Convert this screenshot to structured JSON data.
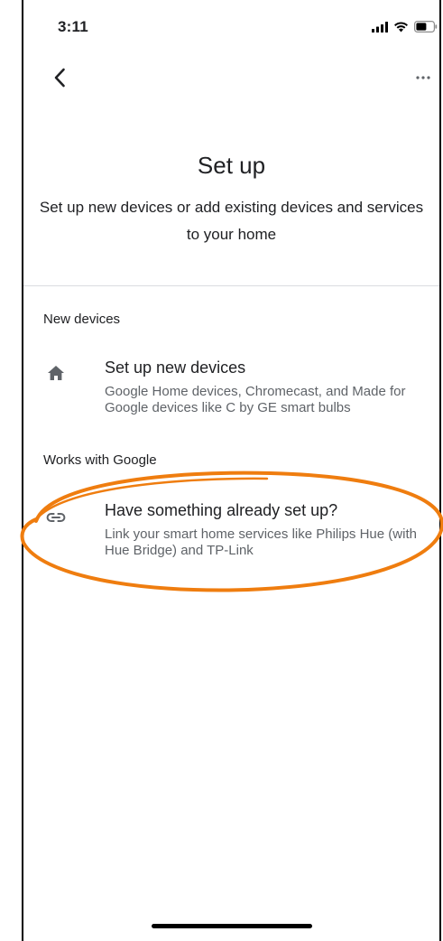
{
  "status_bar": {
    "time": "3:11",
    "icons": [
      "cellular-signal-icon",
      "wifi-icon",
      "battery-icon"
    ]
  },
  "nav": {
    "back_icon": "chevron-left-icon",
    "more_icon": "more-horizontal-icon"
  },
  "header": {
    "title": "Set up",
    "subtitle": "Set up new devices or add existing devices and services to your home"
  },
  "sections": [
    {
      "label": "New devices",
      "items": [
        {
          "icon": "home-icon",
          "title": "Set up new devices",
          "description": "Google Home devices, Chromecast, and Made for Google devices like C by GE smart bulbs"
        }
      ]
    },
    {
      "label": "Works with Google",
      "items": [
        {
          "icon": "link-icon",
          "title": "Have something already set up?",
          "description": "Link your smart home services like Philips Hue (with Hue Bridge) and TP-Link"
        }
      ]
    }
  ],
  "colors": {
    "annotation": "#EF7D0F",
    "primary_text": "#202124",
    "secondary_text": "#5F6368",
    "icon": "#5F6368",
    "divider": "#DADCE0"
  }
}
